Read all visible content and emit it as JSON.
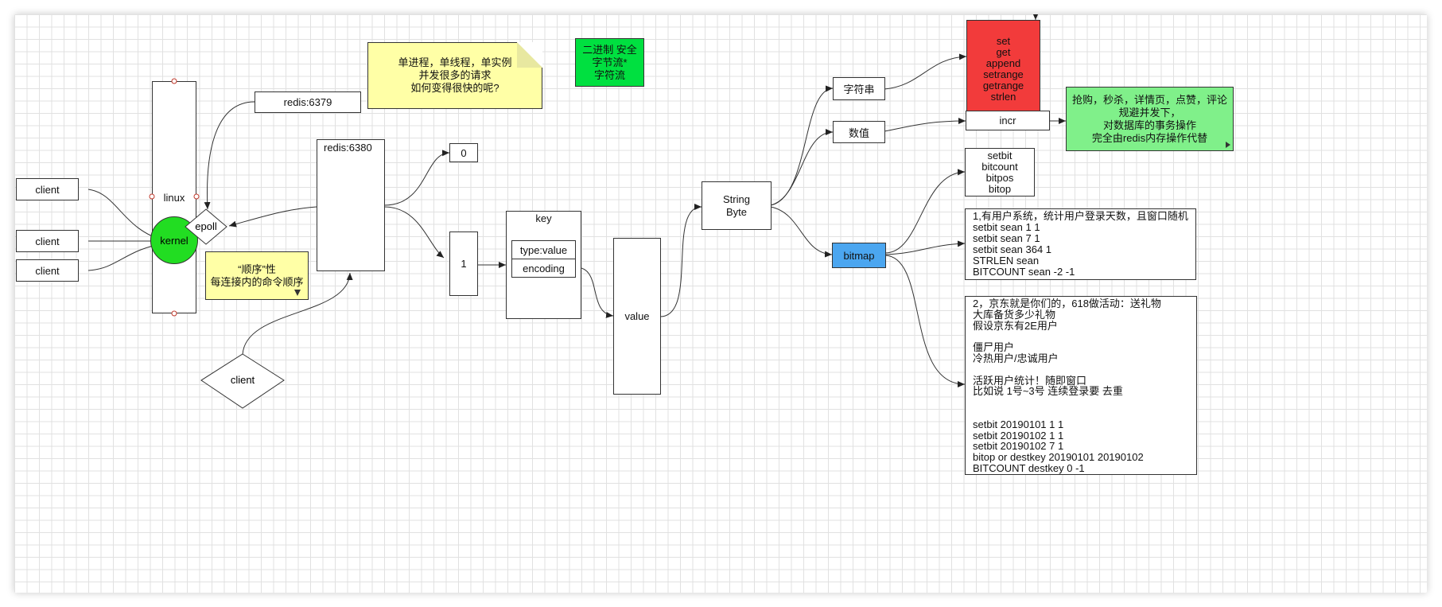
{
  "colors": {
    "kernel": "#22dd22",
    "red": "#f23b3b",
    "green": "#00e040",
    "lightgreen": "#80f08a",
    "yellow": "#ffffa6",
    "blue": "#4ba6f0"
  },
  "clients": [
    "client",
    "client",
    "client"
  ],
  "linux": "linux",
  "kernel": "kernel",
  "epoll": "epoll",
  "redis6379": "redis:6379",
  "redis6380": "redis:6380",
  "note_process": "单进程，单线程，单实例\n并发很多的请求\n如何变得很快的呢?",
  "note_order": "“顺序”性\n每连接内的命令顺序",
  "binary_safe": "二进制  安全\n字节流*\n字符流",
  "client_diamond": "client",
  "db0": "0",
  "db1": "1",
  "key": {
    "title": "key",
    "type": "type:value",
    "encoding": "encoding"
  },
  "value": "value",
  "string_byte": "String\nByte",
  "string_type": "字符串",
  "numeric_type": "数值",
  "bitmap": "bitmap",
  "string_cmds": "set\nget\nappend\nsetrange\ngetrange\nstrlen",
  "incr": "incr",
  "incr_note": "抢购，秒杀，详情页，点赞，评论\n规避并发下，\n对数据库的事务操作\n完全由redis内存操作代替",
  "bit_cmds": "setbit\nbitcount\nbitpos\nbitop",
  "case1": "1,有用户系统，统计用户登录天数，且窗口随机\nsetbit sean 1 1\nsetbit sean 7 1\nsetbit sean 364 1\nSTRLEN sean\nBITCOUNT sean -2 -1",
  "case2": "2，京东就是你们的，618做活动：送礼物\n大库备货多少礼物\n假设京东有2E用户\n\n僵尸用户\n冷热用户/忠诚用户\n\n活跃用户统计！随即窗口\n比如说 1号~3号  连续登录要      去重\n\n\nsetbit 20190101   1  1\nsetbit 20190102   1  1\nsetbit 20190102   7  1\nbitop   or    destkey 20190101  20190102\nBITCOUNT  destkey  0 -1"
}
